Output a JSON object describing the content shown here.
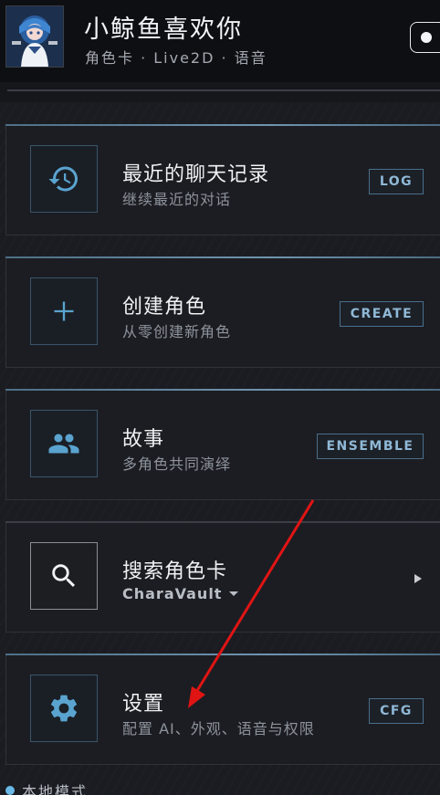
{
  "header": {
    "title": "小鲸鱼喜欢你",
    "subtitle": "角色卡 · Live2D · 语音"
  },
  "cards": [
    {
      "title": "最近的聊天记录",
      "subtitle": "继续最近的对话",
      "tag": "LOG",
      "icon": "history-icon"
    },
    {
      "title": "创建角色",
      "subtitle": "从零创建新角色",
      "tag": "CREATE",
      "icon": "plus-icon"
    },
    {
      "title": "故事",
      "subtitle": "多角色共同演绎",
      "tag": "ENSEMBLE",
      "icon": "group-icon"
    },
    {
      "title": "搜索角色卡",
      "selector_value": "CharaVault",
      "icon": "search-icon"
    },
    {
      "title": "设置",
      "subtitle": "配置 AI、外观、语音与权限",
      "tag": "CFG",
      "icon": "gear-icon"
    }
  ],
  "footer": {
    "mode_label": "本地模式"
  },
  "colors": {
    "accent": "#6ab8e6",
    "tag_text": "#8fb8d6",
    "annotation_arrow": "#e11414"
  }
}
